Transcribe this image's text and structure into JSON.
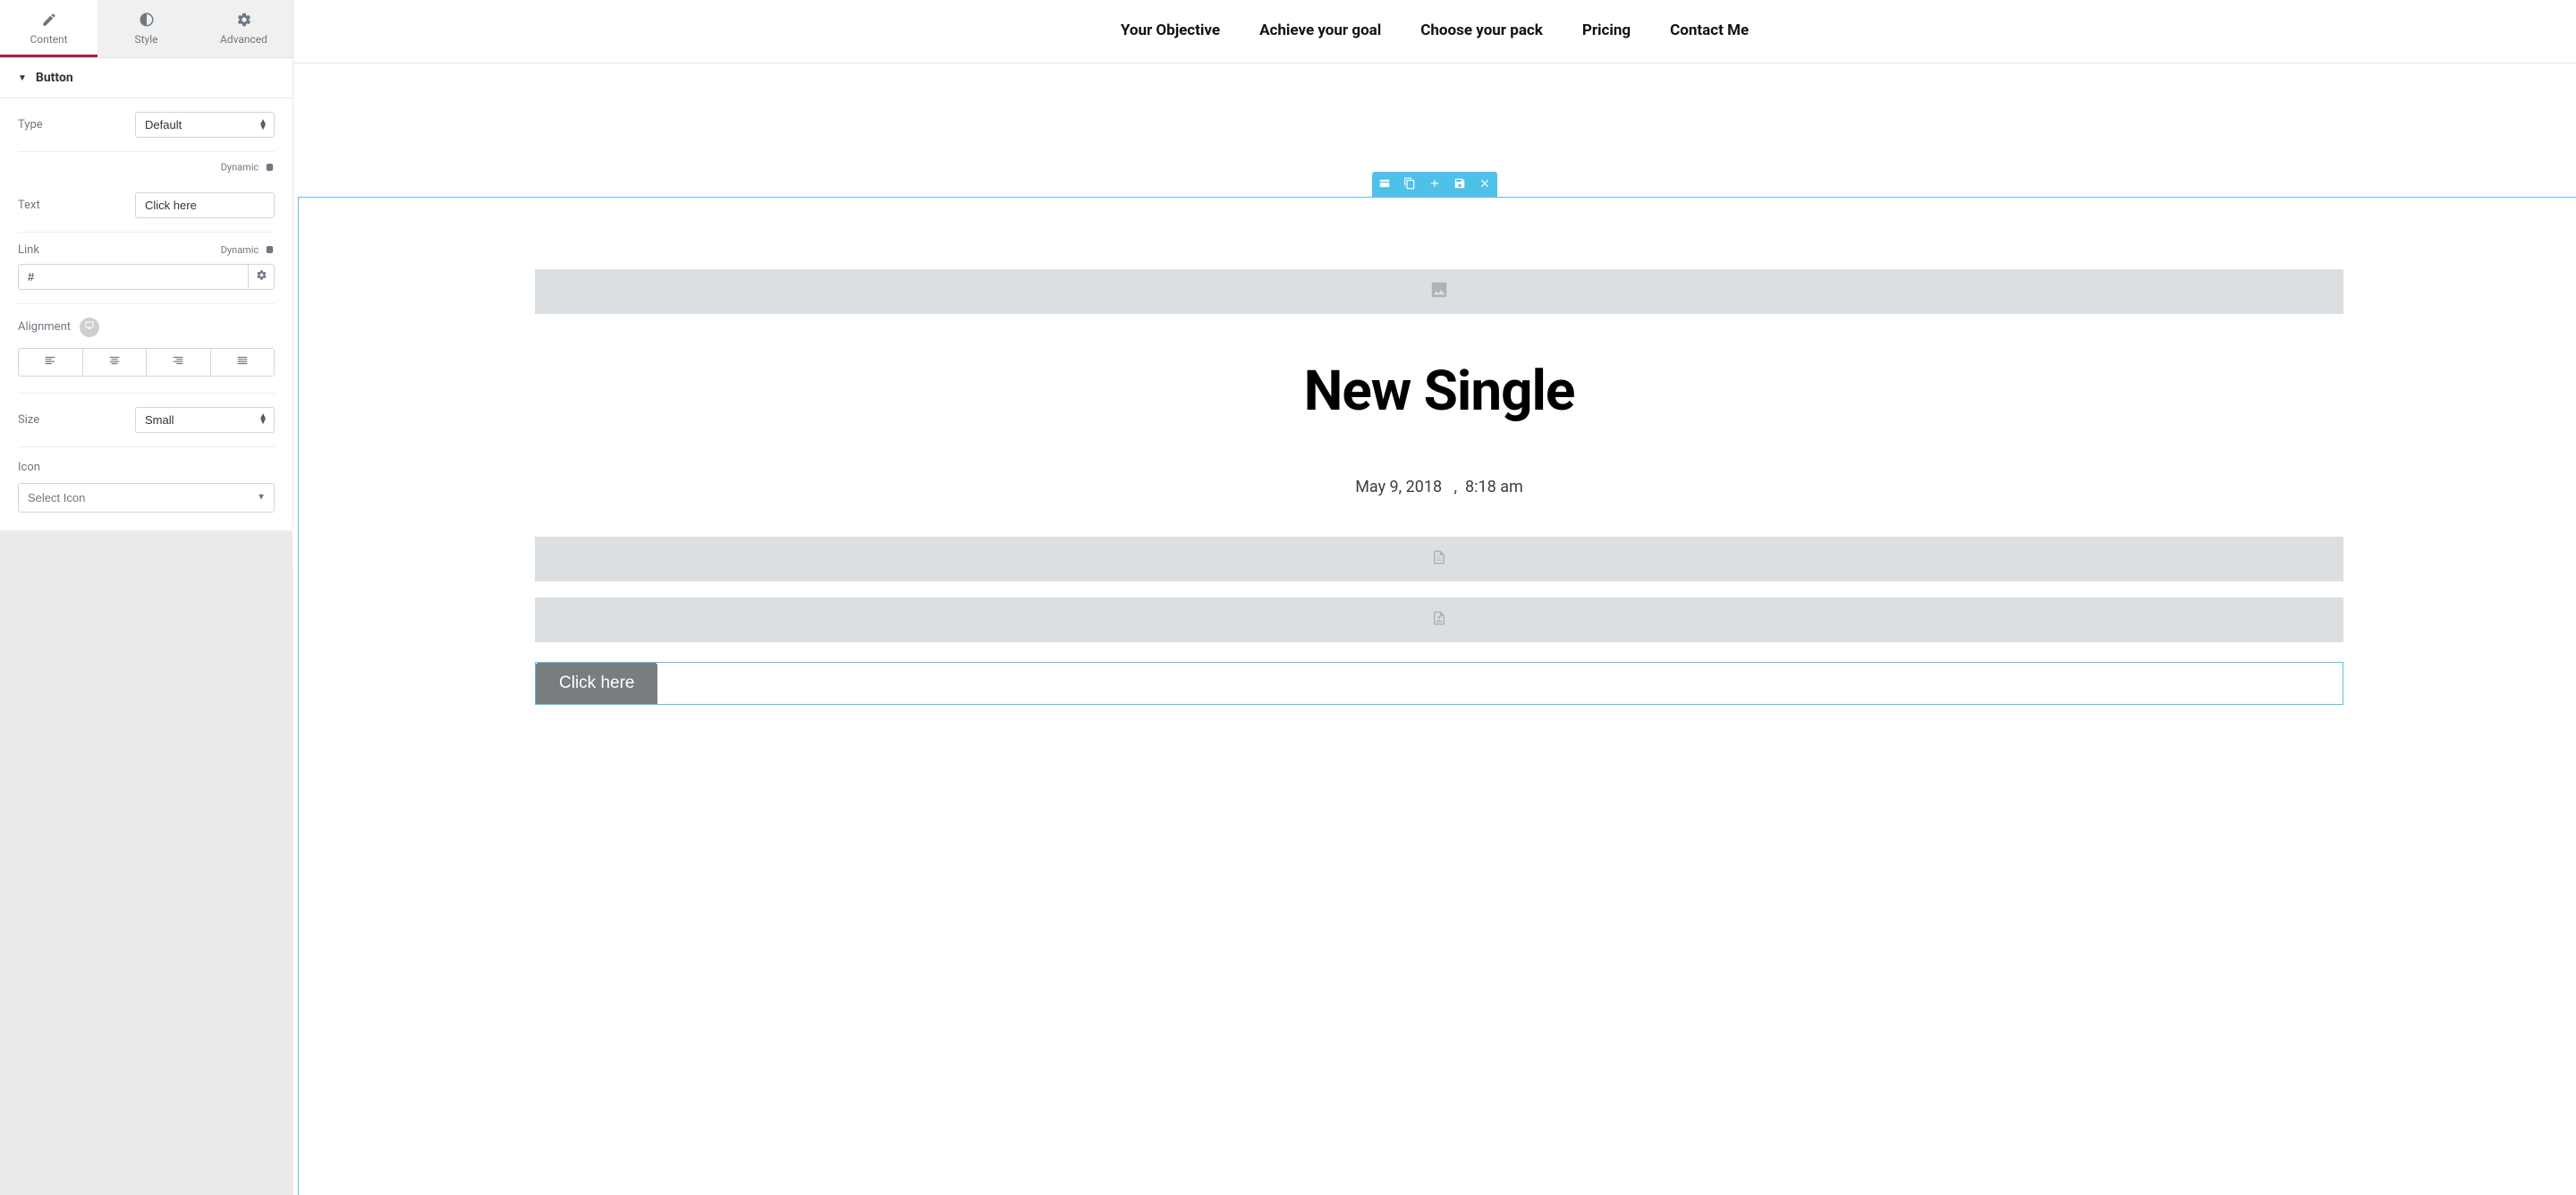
{
  "panel": {
    "tabs": {
      "content": "Content",
      "style": "Style",
      "advanced": "Advanced"
    },
    "section_title": "Button",
    "type": {
      "label": "Type",
      "value": "Default"
    },
    "dynamic_label": "Dynamic",
    "text": {
      "label": "Text",
      "value": "Click here"
    },
    "link": {
      "label": "Link",
      "value": "#"
    },
    "alignment": {
      "label": "Alignment"
    },
    "size": {
      "label": "Size",
      "value": "Small"
    },
    "icon": {
      "label": "Icon",
      "placeholder": "Select Icon"
    }
  },
  "nav": {
    "items": [
      "Your Objective",
      "Achieve your goal",
      "Choose your pack",
      "Pricing",
      "Contact Me"
    ]
  },
  "post": {
    "title": "New Single",
    "date": "May 9, 2018",
    "time": "8:18 am"
  },
  "preview_button": {
    "label": "Click here"
  }
}
